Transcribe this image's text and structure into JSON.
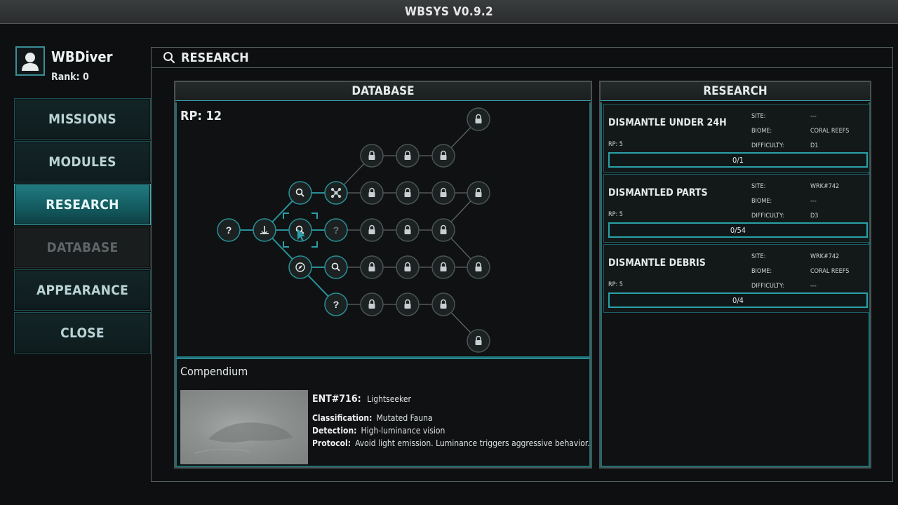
{
  "window": {
    "title": "WBSYS V0.9.2"
  },
  "profile": {
    "username": "WBDiver",
    "rank": "Rank: 0"
  },
  "nav": {
    "missions": "MISSIONS",
    "modules": "MODULES",
    "research": "RESEARCH",
    "database": "DATABASE",
    "appearance": "APPEARANCE",
    "close": "CLOSE"
  },
  "main": {
    "title": "RESEARCH"
  },
  "database": {
    "heading": "DATABASE",
    "rp": "RP: 12"
  },
  "compendium": {
    "title": "Compendium",
    "entry_id": "ENT#716:",
    "entry_name": "Lightseeker",
    "classification_label": "Classification:",
    "classification": "Mutated Fauna",
    "detection_label": "Detection:",
    "detection": "High-luminance vision",
    "protocol_label": "Protocol:",
    "protocol": "Avoid light emission. Luminance triggers aggressive behavior."
  },
  "research": {
    "heading": "RESEARCH",
    "site_label": "SITE:",
    "biome_label": "BIOME:",
    "difficulty_label": "DIFFICULTY:",
    "tasks": [
      {
        "name": "DISMANTLE UNDER 24H",
        "rp": "RP: 5",
        "site": "---",
        "biome": "CORAL REEFS",
        "difficulty": "D1",
        "progress": "0/1"
      },
      {
        "name": "DISMANTLED PARTS",
        "rp": "RP: 5",
        "site": "WRK#742",
        "biome": "---",
        "difficulty": "D3",
        "progress": "0/54"
      },
      {
        "name": "DISMANTLE DEBRIS",
        "rp": "RP: 5",
        "site": "WRK#742",
        "biome": "CORAL REEFS",
        "difficulty": "---",
        "progress": "0/4"
      }
    ]
  },
  "tree": {
    "line_color": "#2a8f98",
    "node_fill": "#1c2122",
    "node_stroke": "#4a5455",
    "node_icons": [
      "question-icon",
      "anchor-icon",
      "search-icon",
      "question-icon",
      "compass-icon",
      "search-icon",
      "question-icon",
      "network-icon",
      "lock-icon",
      "lock-icon"
    ]
  }
}
